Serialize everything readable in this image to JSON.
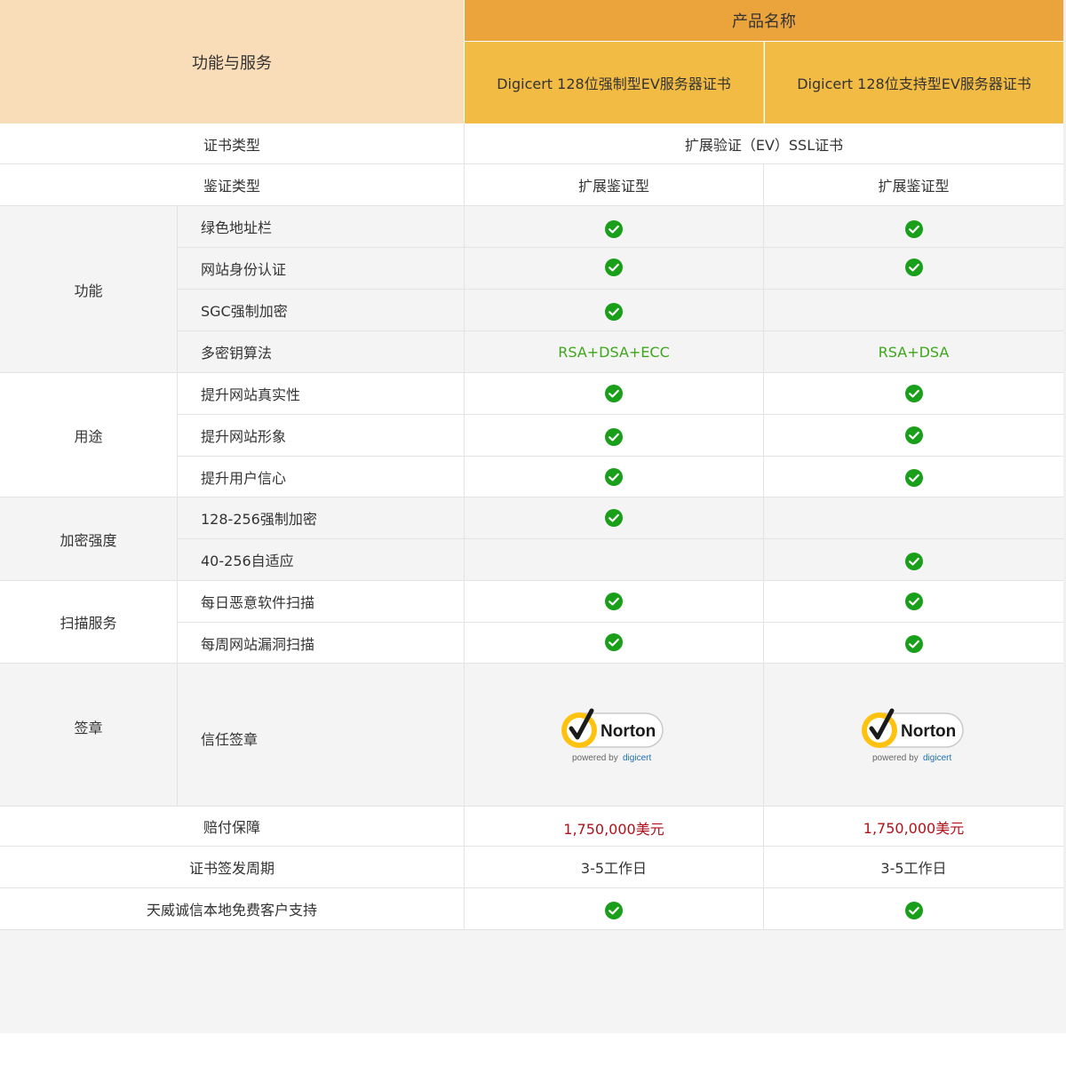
{
  "header": {
    "feature_col": "功能与服务",
    "product_col": "产品名称",
    "products": [
      "Digicert 128位强制型EV服务器证书",
      "Digicert 128位支持型EV服务器证书"
    ]
  },
  "rows": {
    "cert_type": {
      "label": "证书类型",
      "value": "扩展验证（EV）SSL证书"
    },
    "auth_type": {
      "label": "鉴证类型",
      "p1": "扩展鉴证型",
      "p2": "扩展鉴证型"
    },
    "groups": {
      "function": {
        "label": "功能",
        "items": [
          "绿色地址栏",
          "网站身份认证",
          "SGC强制加密",
          "多密钥算法"
        ],
        "algo_p1": "RSA+DSA+ECC",
        "algo_p2": "RSA+DSA"
      },
      "usage": {
        "label": "用途",
        "items": [
          "提升网站真实性",
          "提升网站形象",
          "提升用户信心"
        ]
      },
      "strength": {
        "label": "加密强度",
        "items": [
          "128-256强制加密",
          "40-256自适应"
        ]
      },
      "scan": {
        "label": "扫描服务",
        "items": [
          "每日恶意软件扫描",
          "每周网站漏洞扫描"
        ]
      },
      "seal": {
        "label": "签章",
        "items": [
          "信任签章"
        ]
      }
    },
    "warranty": {
      "label": "赔付保障",
      "p1": "1,750,000美元",
      "p2": "1,750,000美元"
    },
    "issue": {
      "label": "证书签发周期",
      "p1": "3-5工作日",
      "p2": "3-5工作日"
    },
    "support": {
      "label": "天威诚信本地免费客户支持"
    }
  },
  "seal": {
    "brand": "Norton",
    "powered": "powered by",
    "digicert": "digicert"
  },
  "colors": {
    "check": "#1a9f1a",
    "header_light": "#f9ddb8",
    "header_orange": "#eba43c",
    "header_gold": "#f2bb43",
    "algo_green": "#3ea61a",
    "warranty_red": "#b0121a"
  },
  "icons": {
    "check": "check-circle-icon",
    "seal": "norton-seal-icon"
  }
}
